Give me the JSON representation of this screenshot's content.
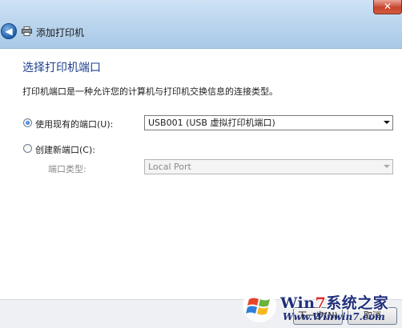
{
  "window": {
    "title": "添加打印机",
    "close_glyph": "✕",
    "back_glyph": "◀"
  },
  "page": {
    "title": "选择打印机端口",
    "description": "打印机端口是一种允许您的计算机与打印机交换信息的连接类型。"
  },
  "options": {
    "use_existing": {
      "label": "使用现有的端口(U):",
      "selected": true,
      "value": "USB001 (USB 虚拟打印机端口)"
    },
    "create_new": {
      "label": "创建新端口(C):",
      "selected": false,
      "port_type_label": "端口类型:",
      "port_type_value": "Local Port"
    }
  },
  "footer": {
    "next_label": "下一步(N)",
    "cancel_label": "取消"
  },
  "watermark": {
    "brand_prefix": "Win",
    "brand_seven": "7",
    "brand_suffix": "系统之家",
    "url": "Www.Winwin7.com"
  },
  "colors": {
    "title_blue": "#1f3f8c",
    "titlebar": "#bcd6ee",
    "close_red": "#c8442d"
  },
  "icons": {
    "back": "back-arrow-icon",
    "printer": "printer-icon",
    "close": "close-icon",
    "windows_logo": "windows-logo-icon"
  }
}
